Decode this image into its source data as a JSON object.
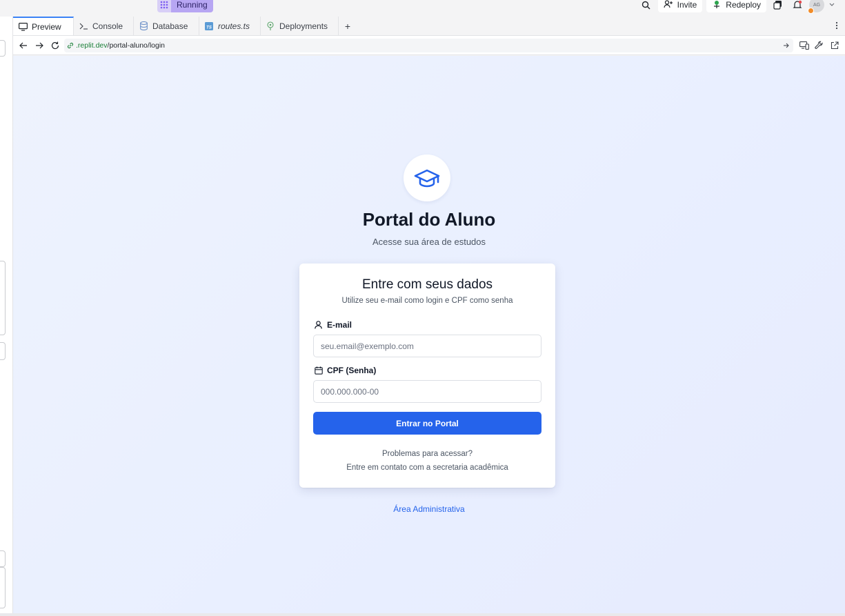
{
  "topbar": {
    "status_label": "Running",
    "invite_label": "Invite",
    "redeploy_label": "Redeploy",
    "avatar_initials": "AG"
  },
  "tabs": [
    {
      "label": "Preview",
      "icon": "monitor-icon"
    },
    {
      "label": "Console",
      "icon": "terminal-icon"
    },
    {
      "label": "Database",
      "icon": "database-icon"
    },
    {
      "label": "routes.ts",
      "icon": "typescript-file-icon"
    },
    {
      "label": "Deployments",
      "icon": "deployments-icon"
    }
  ],
  "url": {
    "host": ".replit.dev",
    "path": "/portal-aluno/login"
  },
  "page": {
    "title": "Portal do Aluno",
    "subtitle": "Acesse sua área de estudos",
    "card_title": "Entre com seus dados",
    "card_subtitle": "Utilize seu e-mail como login e CPF como senha",
    "email_label": "E-mail",
    "email_placeholder": "seu.email@exemplo.com",
    "cpf_label": "CPF (Senha)",
    "cpf_placeholder": "000.000.000-00",
    "submit_label": "Entrar no Portal",
    "help_line1": "Problemas para acessar?",
    "help_line2": "Entre em contato com a secretaria acadêmica",
    "admin_link": "Área Administrativa"
  },
  "colors": {
    "primary": "#2563eb",
    "running_badge": "#b7a6f3",
    "url_host": "#1a7f37"
  }
}
